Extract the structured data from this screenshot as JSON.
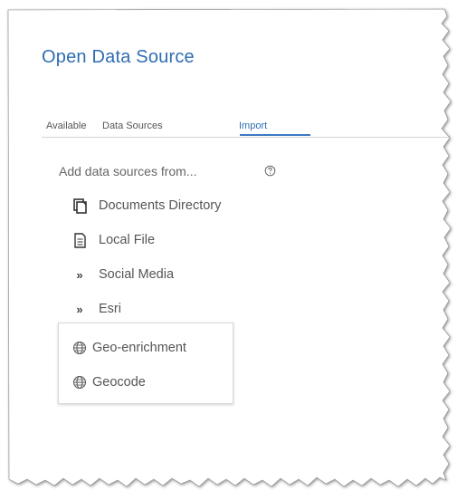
{
  "dialog": {
    "title": "Open Data Source"
  },
  "tabs": [
    {
      "label": "Available"
    },
    {
      "label": "Data Sources"
    },
    {
      "label": "Import",
      "active": true
    }
  ],
  "import_panel": {
    "add_label": "Add data sources from...",
    "help_icon": "help-circle-icon",
    "items": [
      {
        "label": "Documents Directory",
        "icon": "documents-icon"
      },
      {
        "label": "Local File",
        "icon": "file-icon"
      },
      {
        "label": "Social Media",
        "icon": "double-chevron-right-icon"
      },
      {
        "label": "Esri",
        "icon": "double-chevron-right-icon"
      }
    ],
    "esri_submenu": [
      {
        "label": "Geo-enrichment",
        "icon": "globe-icon"
      },
      {
        "label": "Geocode",
        "icon": "globe-icon"
      }
    ]
  },
  "colors": {
    "accent": "#2f6db3",
    "text": "#555555",
    "divider": "#d4d4d4"
  }
}
